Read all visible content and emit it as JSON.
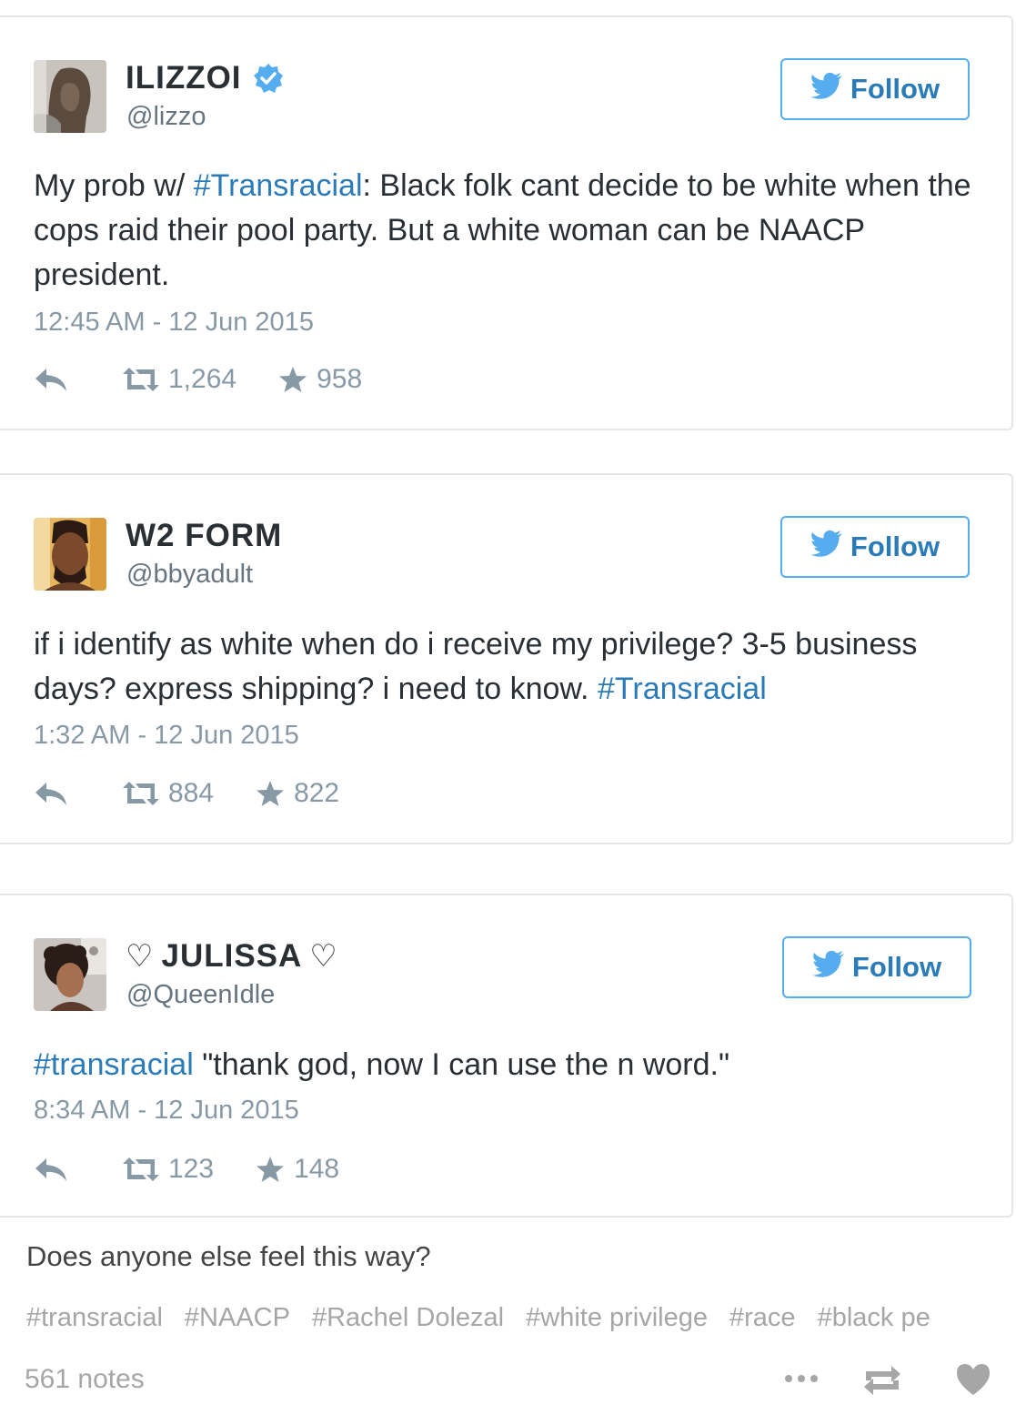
{
  "tweets": [
    {
      "display_name": "ILIZZOI",
      "handle": "@lizzo",
      "verified": true,
      "follow_label": "Follow",
      "text_segments": [
        {
          "text": "My prob w/ ",
          "hashtag": false
        },
        {
          "text": "#Transracial",
          "hashtag": true
        },
        {
          "text": ": Black folk cant decide to be white when the cops raid their pool party. But a white woman can be NAACP president.",
          "hashtag": false
        }
      ],
      "timestamp": "12:45 AM - 12 Jun 2015",
      "retweets": "1,264",
      "favorites": "958"
    },
    {
      "display_name": "W2 FORM",
      "handle": "@bbyadult",
      "verified": false,
      "follow_label": "Follow",
      "text_segments": [
        {
          "text": "if i identify as white when do i receive my privilege? 3-5 business days? express shipping? i need to know. ",
          "hashtag": false
        },
        {
          "text": "#Transracial",
          "hashtag": true
        }
      ],
      "timestamp": "1:32 AM - 12 Jun 2015",
      "retweets": "884",
      "favorites": "822"
    },
    {
      "display_name": "JULISSA",
      "display_name_decoration": "♡",
      "handle": "@QueenIdle",
      "verified": false,
      "follow_label": "Follow",
      "text_segments": [
        {
          "text": "#transracial",
          "hashtag": true
        },
        {
          "text": " \"thank god, now I can use the n word.\"",
          "hashtag": false
        }
      ],
      "timestamp": "8:34 AM - 12 Jun 2015",
      "retweets": "123",
      "favorites": "148"
    }
  ],
  "post": {
    "caption": "Does anyone else feel this way?",
    "tags": [
      "#transracial",
      "#NAACP",
      "#Rachel Dolezal",
      "#white privilege",
      "#race",
      "#black pe"
    ],
    "notes": "561 notes"
  },
  "icons": {
    "verified": "verified-badge-icon",
    "follow": "twitter-bird-icon",
    "reply": "reply-icon",
    "retweet": "retweet-icon",
    "favorite": "star-icon",
    "more": "more-dots-icon",
    "reblog": "reblog-icon",
    "like": "heart-icon"
  },
  "colors": {
    "twitter_blue": "#55acee",
    "link_blue": "#2b7bb9",
    "text": "#292f33",
    "secondary_text": "#66757f",
    "meta_text": "#8899a6",
    "tumblr_gray": "#a6a6a6"
  }
}
